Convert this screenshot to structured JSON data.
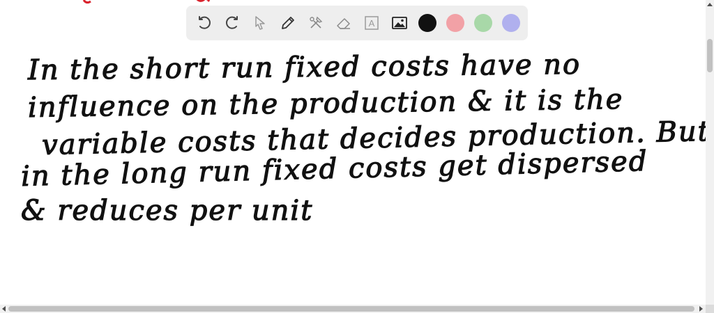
{
  "toolbar": {
    "tools": [
      {
        "name": "undo-icon"
      },
      {
        "name": "redo-icon"
      },
      {
        "name": "select-pointer-icon"
      },
      {
        "name": "pen-icon"
      },
      {
        "name": "tools-icon"
      },
      {
        "name": "eraser-icon"
      },
      {
        "name": "text-icon",
        "glyph": "A"
      },
      {
        "name": "image-icon"
      }
    ],
    "colors": [
      "#111111",
      "#f2a1a6",
      "#a8d8a8",
      "#b0b0ee"
    ],
    "selected_color": "#111111"
  },
  "note": {
    "lines": [
      "In the short run fixed costs have no",
      "influence on the production & it is the",
      "variable costs that decides production. But",
      "in the long run fixed costs get dispersed",
      "& reduces per unit"
    ]
  }
}
